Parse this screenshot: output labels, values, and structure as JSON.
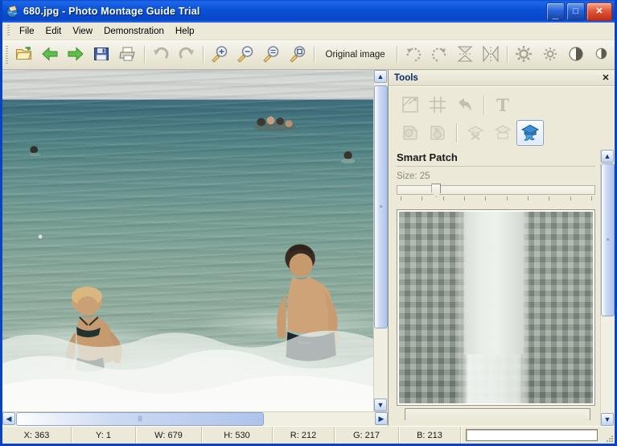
{
  "window": {
    "title": "680.jpg - Photo Montage Guide Trial",
    "app_icon": "photo-montage-icon",
    "minimize_label": "_",
    "maximize_label": "□",
    "close_label": "✕"
  },
  "menu": {
    "items": [
      {
        "label": "File"
      },
      {
        "label": "Edit"
      },
      {
        "label": "View"
      },
      {
        "label": "Demonstration"
      },
      {
        "label": "Help"
      }
    ]
  },
  "toolbar": {
    "original_image_label": "Original image",
    "buttons": [
      {
        "name": "open-icon"
      },
      {
        "name": "back-arrow-icon"
      },
      {
        "name": "forward-arrow-icon"
      },
      {
        "name": "save-icon"
      },
      {
        "name": "print-icon"
      },
      {
        "name": "undo-icon"
      },
      {
        "name": "redo-icon"
      },
      {
        "name": "zoom-in-icon"
      },
      {
        "name": "zoom-out-icon"
      },
      {
        "name": "zoom-actual-icon"
      },
      {
        "name": "zoom-fit-icon"
      },
      {
        "name": "rotate-cw-icon"
      },
      {
        "name": "rotate-ccw-icon"
      },
      {
        "name": "flip-vertical-icon"
      },
      {
        "name": "flip-horizontal-icon"
      },
      {
        "name": "brightness-up-icon"
      },
      {
        "name": "brightness-down-icon"
      },
      {
        "name": "contrast-up-icon"
      },
      {
        "name": "contrast-down-icon"
      }
    ]
  },
  "tools_panel": {
    "title": "Tools",
    "close_label": "✕",
    "row1": [
      {
        "name": "crop-resize-icon",
        "enabled": false
      },
      {
        "name": "grid-icon",
        "enabled": false
      },
      {
        "name": "undo-arrow-icon",
        "enabled": false
      },
      {
        "name": "text-tool-icon",
        "enabled": false
      }
    ],
    "row2": [
      {
        "name": "clone-stamp-icon",
        "enabled": false
      },
      {
        "name": "clone-stamp-alt-icon",
        "enabled": false
      },
      {
        "name": "remove-object-icon",
        "enabled": false
      },
      {
        "name": "patch-tool-icon",
        "enabled": false
      },
      {
        "name": "smart-patch-icon",
        "enabled": true
      }
    ],
    "section_title": "Smart Patch",
    "size_label": "Size: 25",
    "size_value": 25,
    "slider_percent": 20,
    "tick_count": 10,
    "preview_name": "smart-patch-preview"
  },
  "image_view": {
    "photo_description": "beach-sea-photo",
    "v_scroll": {
      "up_label": "▲",
      "down_label": "▼",
      "thumb_top_pct": 2,
      "thumb_height_pct": 74
    },
    "h_scroll": {
      "left_label": "◀",
      "right_label": "▶",
      "thumb_left_pct": 1,
      "thumb_width_pct": 69
    }
  },
  "status_bar": {
    "x": "X: 363",
    "y": "Y: 1",
    "w": "W: 679",
    "h": "H: 530",
    "r": "R: 212",
    "g": "G: 217",
    "b": "B: 213",
    "message": "",
    "message_placeholder": ""
  },
  "colors": {
    "title_bar": "#0843c4",
    "chrome": "#ece9d8",
    "accent": "#316ac5",
    "close_button": "#e2573a"
  }
}
